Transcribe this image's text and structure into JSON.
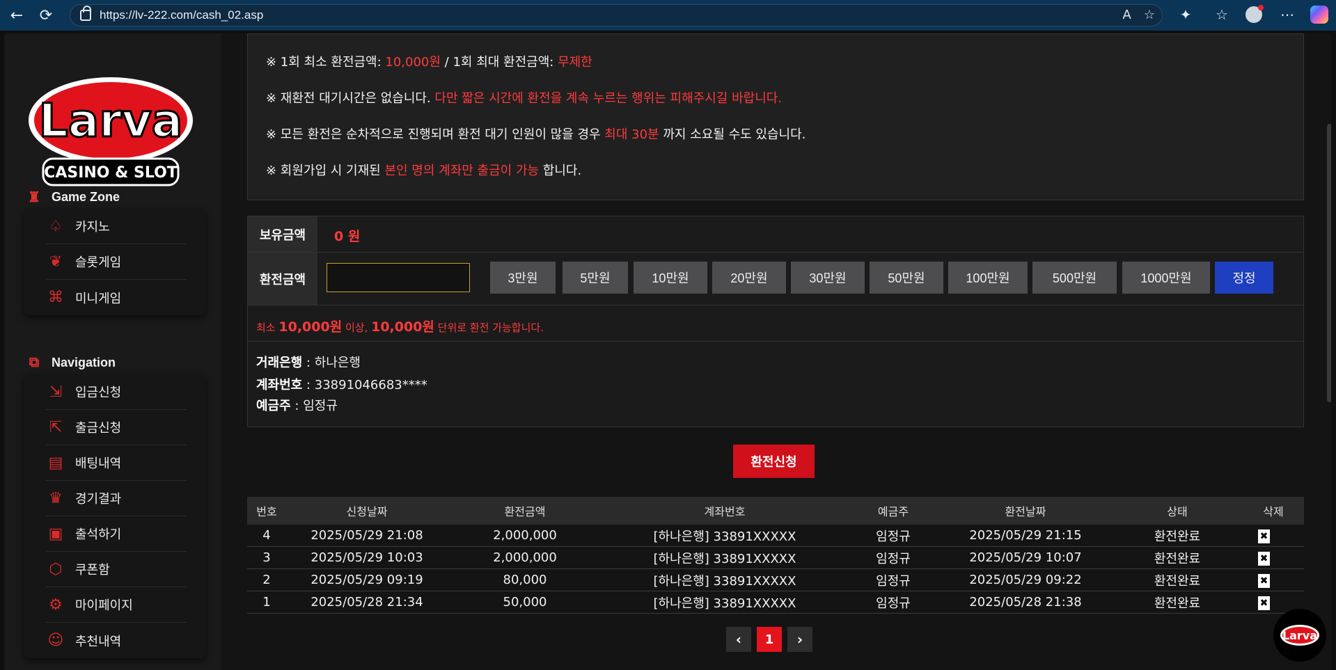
{
  "browser": {
    "url": "https://lv-222.com/cash_02.asp"
  },
  "logo": {
    "text": "Larva",
    "sub": "CASINO & SLOT"
  },
  "sidebar": {
    "game_zone_title": "Game Zone",
    "game_items": [
      "카지노",
      "슬롯게임",
      "미니게임"
    ],
    "nav_title": "Navigation",
    "nav_items": [
      "입금신청",
      "출금신청",
      "배팅내역",
      "경기결과",
      "출석하기",
      "쿠폰함",
      "마이페이지",
      "추천내역"
    ]
  },
  "notice": {
    "line1_a": "※ 1회 최소 환전금액: ",
    "line1_b": "10,000원",
    "line1_c": " / 1회 최대 환전금액: ",
    "line1_d": "무제한",
    "line2_a": "※ 재환전 대기시간은 없습니다. ",
    "line2_b": "다만 짧은 시간에 환전을 계속 누르는 행위는 피해주시길 바랍니다.",
    "line3_a": "※ 모든 환전은 순차적으로 진행되며 환전 대기 인원이 많을 경우 ",
    "line3_b": "최대 30분",
    "line3_c": " 까지 소요될 수도 있습니다.",
    "line4_a": "※ 회원가입 시 기재된 ",
    "line4_b": "본인 명의 계좌만 출금이 가능",
    "line4_c": " 합니다."
  },
  "form": {
    "balance_label": "보유금액",
    "balance_value": "0 원",
    "amount_label": "환전금액",
    "amount_value": "",
    "quick_buttons": [
      "3만원",
      "5만원",
      "10만원",
      "20만원",
      "30만원",
      "50만원",
      "100만원",
      "500만원",
      "1000만원"
    ],
    "reset_label": "정정",
    "hint_a": "최소 ",
    "hint_b": "10,000원",
    "hint_c": " 이상, ",
    "hint_d": "10,000원",
    "hint_e": " 단위로 환전 가능합니다.",
    "bank_label": "거래은행",
    "bank_value": " : 하나은행",
    "account_label": "계좌번호",
    "account_value": " : 33891046683****",
    "holder_label": "예금주",
    "holder_value": " : 임정규",
    "submit_label": "환전신청"
  },
  "table": {
    "headers": [
      "번호",
      "신청날짜",
      "환전금액",
      "계좌번호",
      "예금주",
      "환전날짜",
      "상태",
      "삭제"
    ],
    "rows": [
      [
        "4",
        "2025/05/29 21:08",
        "2,000,000",
        "[하나은행] 33891XXXXX",
        "임정규",
        "2025/05/29 21:15",
        "환전완료"
      ],
      [
        "3",
        "2025/05/29 10:03",
        "2,000,000",
        "[하나은행] 33891XXXXX",
        "임정규",
        "2025/05/29 10:07",
        "환전완료"
      ],
      [
        "2",
        "2025/05/29 09:19",
        "80,000",
        "[하나은행] 33891XXXXX",
        "임정규",
        "2025/05/29 09:22",
        "환전완료"
      ],
      [
        "1",
        "2025/05/28 21:34",
        "50,000",
        "[하나은행] 33891XXXXX",
        "임정규",
        "2025/05/28 21:38",
        "환전완료"
      ]
    ],
    "delete_glyph": "✖"
  },
  "pager": {
    "prev": "‹",
    "current": "1",
    "next": "›"
  },
  "colors": {
    "accent_red": "#ff3b3b",
    "submit_red": "#d0101b",
    "reset_blue": "#1e3fbf"
  }
}
